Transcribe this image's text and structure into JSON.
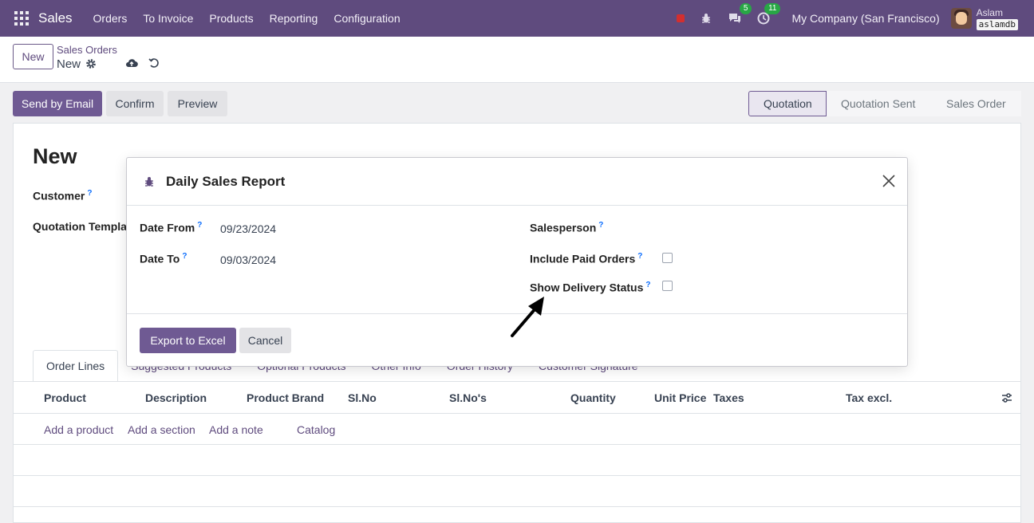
{
  "navbar": {
    "app_name": "Sales",
    "menu": [
      "Orders",
      "To Invoice",
      "Products",
      "Reporting",
      "Configuration"
    ],
    "chat_badge": "5",
    "activity_badge": "11",
    "company": "My Company (San Francisco)",
    "user_name": "Aslam",
    "db_name": "aslamdb"
  },
  "control": {
    "new_label": "New",
    "breadcrumb_parent": "Sales Orders",
    "breadcrumb_current": "New"
  },
  "actions": {
    "send_email": "Send by Email",
    "confirm": "Confirm",
    "preview": "Preview",
    "statuses": [
      "Quotation",
      "Quotation Sent",
      "Sales Order"
    ],
    "active_status": "Quotation"
  },
  "form": {
    "title": "New",
    "customer_label": "Customer",
    "template_label": "Quotation Templa",
    "tabs": [
      "Order Lines",
      "Suggested Products",
      "Optional Products",
      "Other Info",
      "Order History",
      "Customer Signature"
    ],
    "columns": [
      "Product",
      "Description",
      "Product Brand",
      "Sl.No",
      "Sl.No's",
      "Quantity",
      "Unit Price",
      "Taxes",
      "Tax excl."
    ],
    "add_product": "Add a product",
    "add_section": "Add a section",
    "add_note": "Add a note",
    "catalog": "Catalog"
  },
  "modal": {
    "title": "Daily Sales Report",
    "date_from_label": "Date From",
    "date_from_value": "09/23/2024",
    "date_to_label": "Date To",
    "date_to_value": "09/03/2024",
    "salesperson_label": "Salesperson",
    "include_paid_label": "Include Paid Orders",
    "include_paid_checked": false,
    "show_delivery_label": "Show Delivery Status",
    "show_delivery_checked": false,
    "export_label": "Export to Excel",
    "cancel_label": "Cancel"
  },
  "help_marker": "?",
  "colors": {
    "navbar": "#5f4b7e",
    "primary": "#6f5a93",
    "help": "#0d6efd"
  }
}
